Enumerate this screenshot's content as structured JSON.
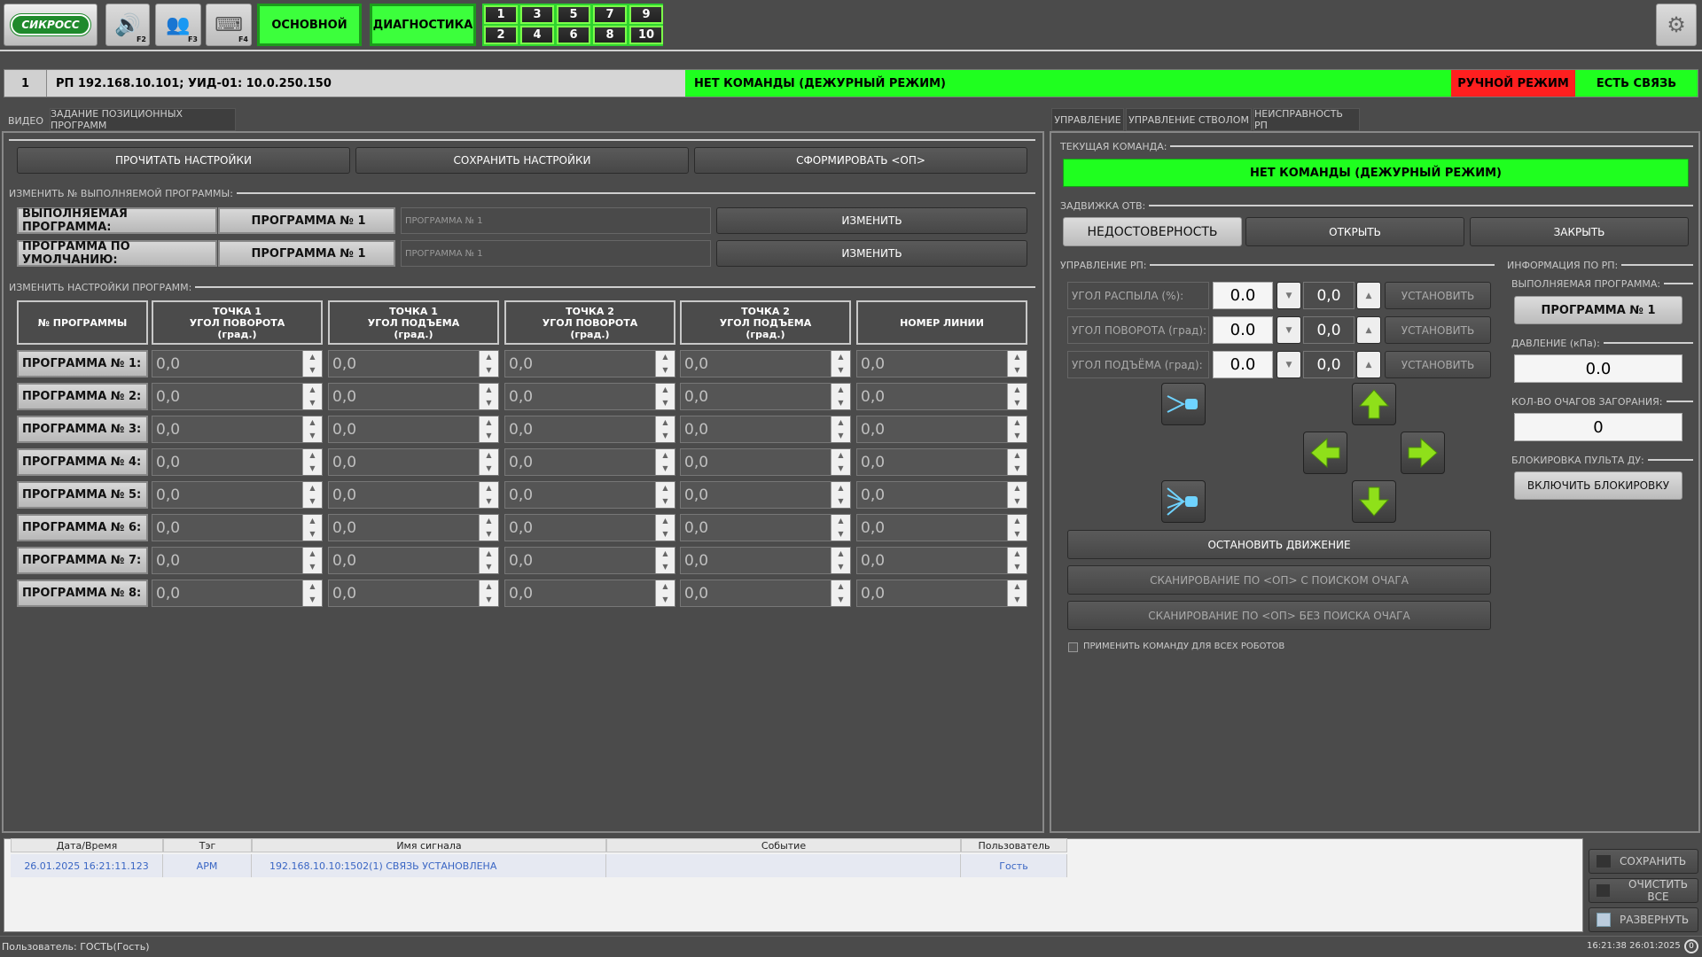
{
  "header": {
    "logo": "СИКРОСС",
    "f2": "F2",
    "f3": "F3",
    "f4": "F4",
    "main_btn": "ОСНОВНОЙ",
    "diag_btn": "ДИАГНОСТИКА",
    "nums_top": [
      "1",
      "3",
      "5",
      "7",
      "9"
    ],
    "nums_bottom": [
      "2",
      "4",
      "6",
      "8",
      "10"
    ]
  },
  "status": {
    "index": "1",
    "address": "РП 192.168.10.101; УИД-01: 10.0.250.150",
    "command": "НЕТ КОМАНДЫ (ДЕЖУРНЫЙ РЕЖИМ)",
    "mode": "РУЧНОЙ РЕЖИМ",
    "link": "ЕСТЬ СВЯЗЬ"
  },
  "left": {
    "tabs": [
      "ВИДЕО",
      "ЗАДАНИЕ ПОЗИЦИОННЫХ ПРОГРАММ"
    ],
    "read_btn": "ПРОЧИТАТЬ НАСТРОЙКИ",
    "save_btn": "СОХРАНИТЬ НАСТРОЙКИ",
    "form_btn": "СФОРМИРОВАТЬ <ОП>",
    "change_section": "ИЗМЕНИТЬ № ВЫПОЛНЯЕМОЙ ПРОГРАММЫ:",
    "exec_label": "ВЫПОЛНЯЕМАЯ ПРОГРАММА:",
    "exec_value": "ПРОГРАММА № 1",
    "exec_select": "ПРОГРАММА № 1",
    "default_label": "ПРОГРАММА ПО УМОЛЧАНИЮ:",
    "default_value": "ПРОГРАММА № 1",
    "default_select": "ПРОГРАММА № 1",
    "change_btn": "ИЗМЕНИТЬ",
    "settings_section": "ИЗМЕНИТЬ НАСТРОЙКИ ПРОГРАММ:",
    "columns": [
      "№ ПРОГРАММЫ",
      "ТОЧКА 1\nУГОЛ ПОВОРОТА\n(град.)",
      "ТОЧКА 1\nУГОЛ ПОДЪЕМА\n(град.)",
      "ТОЧКА 2\nУГОЛ ПОВОРОТА\n(град.)",
      "ТОЧКА 2\nУГОЛ ПОДЪЕМА\n(град.)",
      "НОМЕР ЛИНИИ"
    ],
    "rows": [
      {
        "label": "ПРОГРАММА № 1:",
        "vals": [
          "0,0",
          "0,0",
          "0,0",
          "0,0",
          "0,0"
        ]
      },
      {
        "label": "ПРОГРАММА № 2:",
        "vals": [
          "0,0",
          "0,0",
          "0,0",
          "0,0",
          "0,0"
        ]
      },
      {
        "label": "ПРОГРАММА № 3:",
        "vals": [
          "0,0",
          "0,0",
          "0,0",
          "0,0",
          "0,0"
        ]
      },
      {
        "label": "ПРОГРАММА № 4:",
        "vals": [
          "0,0",
          "0,0",
          "0,0",
          "0,0",
          "0,0"
        ]
      },
      {
        "label": "ПРОГРАММА № 5:",
        "vals": [
          "0,0",
          "0,0",
          "0,0",
          "0,0",
          "0,0"
        ]
      },
      {
        "label": "ПРОГРАММА № 6:",
        "vals": [
          "0,0",
          "0,0",
          "0,0",
          "0,0",
          "0,0"
        ]
      },
      {
        "label": "ПРОГРАММА № 7:",
        "vals": [
          "0,0",
          "0,0",
          "0,0",
          "0,0",
          "0,0"
        ]
      },
      {
        "label": "ПРОГРАММА № 8:",
        "vals": [
          "0,0",
          "0,0",
          "0,0",
          "0,0",
          "0,0"
        ]
      }
    ]
  },
  "right": {
    "tabs": [
      "УПРАВЛЕНИЕ",
      "УПРАВЛЕНИЕ СТВОЛОМ",
      "НЕИСПРАВНОСТЬ РП"
    ],
    "current_cmd_section": "ТЕКУЩАЯ КОМАНДА:",
    "current_cmd": "НЕТ КОМАНДЫ (ДЕЖУРНЫЙ РЕЖИМ)",
    "valve_section": "ЗАДВИЖКА ОТВ:",
    "valve_status": "НЕДОСТОВЕРНОСТЬ",
    "open_btn": "ОТКРЫТЬ",
    "close_btn": "ЗАКРЫТЬ",
    "rp_section": "УПРАВЛЕНИЕ РП:",
    "controls": [
      {
        "label": "УГОЛ РАСПЫЛА (%):",
        "current": "0.0",
        "setpoint": "0,0",
        "btn": "УСТАНОВИТЬ"
      },
      {
        "label": "УГОЛ ПОВОРОТА (град):",
        "current": "0.0",
        "setpoint": "0,0",
        "btn": "УСТАНОВИТЬ"
      },
      {
        "label": "УГОЛ ПОДЪЁМА (град):",
        "current": "0.0",
        "setpoint": "0,0",
        "btn": "УСТАНОВИТЬ"
      }
    ],
    "stop_btn": "ОСТАНОВИТЬ ДВИЖЕНИЕ",
    "scan_with": "СКАНИРОВАНИЕ ПО <ОП> С ПОИСКОМ ОЧАГА",
    "scan_without": "СКАНИРОВАНИЕ ПО <ОП> БЕЗ ПОИСКА ОЧАГА",
    "apply_all": "ПРИМЕНИТЬ КОМАНДУ ДЛЯ ВСЕХ РОБОТОВ",
    "info_section": "ИНФОРМАЦИЯ ПО РП:",
    "exec_prog_label": "ВЫПОЛНЯЕМАЯ ПРОГРАММА:",
    "exec_prog": "ПРОГРАММА № 1",
    "pressure_label": "ДАВЛЕНИЕ (кПа):",
    "pressure": "0.0",
    "fires_label": "КОЛ-ВО ОЧАГОВ ЗАГОРАНИЯ:",
    "fires": "0",
    "lock_label": "БЛОКИРОВКА ПУЛЬТА ДУ:",
    "lock_btn": "ВКЛЮЧИТЬ БЛОКИРОВКУ"
  },
  "log": {
    "headers": [
      "Дата/Время",
      "Тэг",
      "Имя сигнала",
      "Событие",
      "Пользователь"
    ],
    "rows": [
      [
        "26.01.2025 16:21:11.123",
        "АРМ",
        "192.168.10.10:1502(1) СВЯЗЬ УСТАНОВЛЕНА",
        "",
        "Гость"
      ]
    ],
    "save_btn": "СОХРАНИТЬ",
    "clear_btn": "ОЧИСТИТЬ ВСЕ",
    "expand_btn": "РАЗВЕРНУТЬ"
  },
  "footer": {
    "user": "Пользователь: ГОСТЬ(Гость)",
    "datetime": "16:21:38 26:01:2025",
    "badge": "0"
  }
}
